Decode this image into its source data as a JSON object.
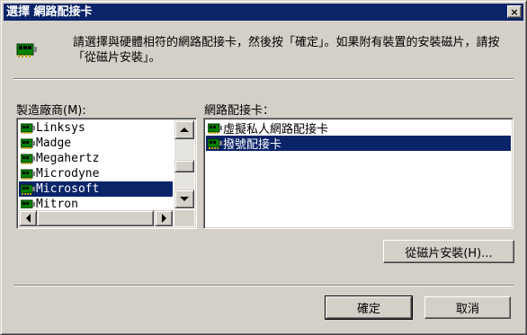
{
  "window": {
    "title": "選擇 網路配接卡",
    "close_glyph": "×"
  },
  "header": {
    "icon": "network-adapter-icon",
    "instructions": "請選擇與硬體相符的網路配接卡，然後按「確定」。如果附有裝置的安裝磁片，請按「從磁片安裝」。"
  },
  "manufacturers": {
    "label": "製造廠商(M):",
    "items": [
      "Linksys",
      "Madge",
      "Megahertz",
      "Microdyne",
      "Microsoft",
      "Mitron"
    ],
    "selected": "Microsoft"
  },
  "adapters": {
    "label": "網路配接卡：",
    "items": [
      "虛擬私人網路配接卡",
      "撥號配接卡"
    ],
    "selected": "撥號配接卡"
  },
  "buttons": {
    "have_disk": "從磁片安裝(H)...",
    "ok": "確定",
    "cancel": "取消"
  },
  "colors": {
    "selection": "#0a246a",
    "face": "#d4d0c8",
    "title_bar": "#0a246a"
  }
}
